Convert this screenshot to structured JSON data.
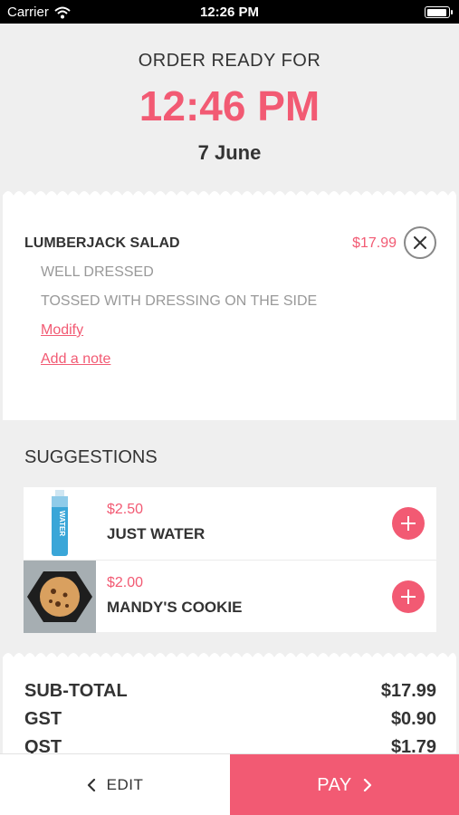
{
  "status_bar": {
    "carrier": "Carrier",
    "time": "12:26 PM"
  },
  "header": {
    "ready_label": "ORDER READY FOR",
    "ready_time": "12:46 PM",
    "ready_date": "7 June"
  },
  "order_item": {
    "name": "LUMBERJACK SALAD",
    "price": "$17.99",
    "options": [
      "WELL DRESSED",
      "TOSSED WITH DRESSING ON THE SIDE"
    ],
    "modify_label": "Modify",
    "note_label": "Add a note"
  },
  "suggestions": {
    "title": "SUGGESTIONS",
    "items": [
      {
        "price": "$2.50",
        "name": "JUST WATER",
        "thumb_text": "WATER"
      },
      {
        "price": "$2.00",
        "name": "MANDY'S COOKIE"
      }
    ]
  },
  "totals": [
    {
      "label": "SUB-TOTAL",
      "value": "$17.99"
    },
    {
      "label": "GST",
      "value": "$0.90"
    },
    {
      "label": "QST",
      "value": "$1.79"
    }
  ],
  "actions": {
    "edit_label": "EDIT",
    "pay_label": "PAY"
  },
  "colors": {
    "accent": "#f25a73",
    "background": "#efefef"
  },
  "icons": [
    "wifi-icon",
    "battery-icon",
    "close-icon",
    "plus-icon",
    "chevron-left-icon",
    "chevron-right-icon"
  ]
}
